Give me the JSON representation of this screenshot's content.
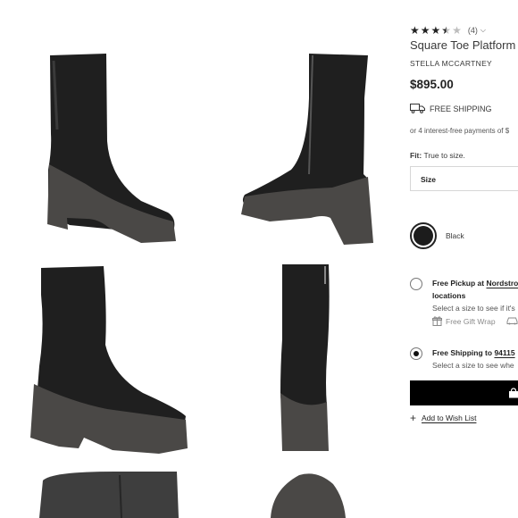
{
  "product": {
    "rating_count": "(4)",
    "title": "Square Toe Platform",
    "brand": "STELLA MCCARTNEY",
    "price": "$895.00",
    "shipping": "FREE SHIPPING",
    "installments": "or 4 interest-free payments of $",
    "fit_label": "Fit:",
    "fit_value": "True to size.",
    "size_label": "Size",
    "color_name": "Black"
  },
  "rating": {
    "value": 3.5,
    "max": 5
  },
  "delivery": {
    "pickup_title": "Free Pickup at",
    "pickup_store": "Nordstro",
    "pickup_title_2": "locations",
    "pickup_sub": "Select a size to see if it's",
    "gift_wrap": "Free Gift Wrap",
    "ship_title": "Free Shipping to",
    "ship_zip": "94115",
    "ship_sub": "Select a size to see whe"
  },
  "wishlist_label": "Add to Wish List",
  "colors": {
    "boot": "#1f1f1f",
    "sole": "#4a4846",
    "text": "#393939"
  }
}
